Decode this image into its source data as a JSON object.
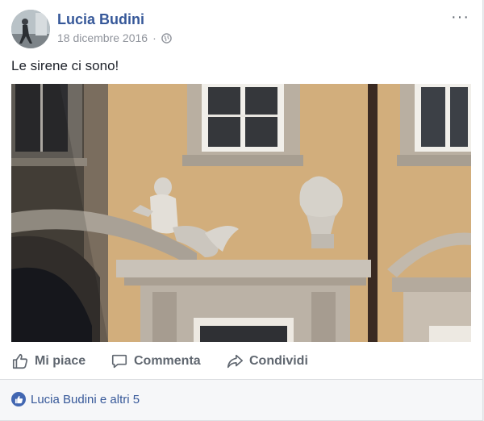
{
  "post": {
    "author": "Lucia Budini",
    "date": "18 dicembre 2016",
    "separator": "·",
    "privacy_icon": "globe-icon",
    "more_label": "···",
    "text": "Le sirene ci sono!"
  },
  "actions": {
    "like": "Mi piace",
    "comment": "Commenta",
    "share": "Condividi"
  },
  "reactions": {
    "summary": "Lucia Budini e altri 5",
    "icon": "thumbs-up-icon"
  },
  "colors": {
    "link": "#365899",
    "reaction_badge": "#4267b2",
    "wall": "#d2ae7c"
  }
}
